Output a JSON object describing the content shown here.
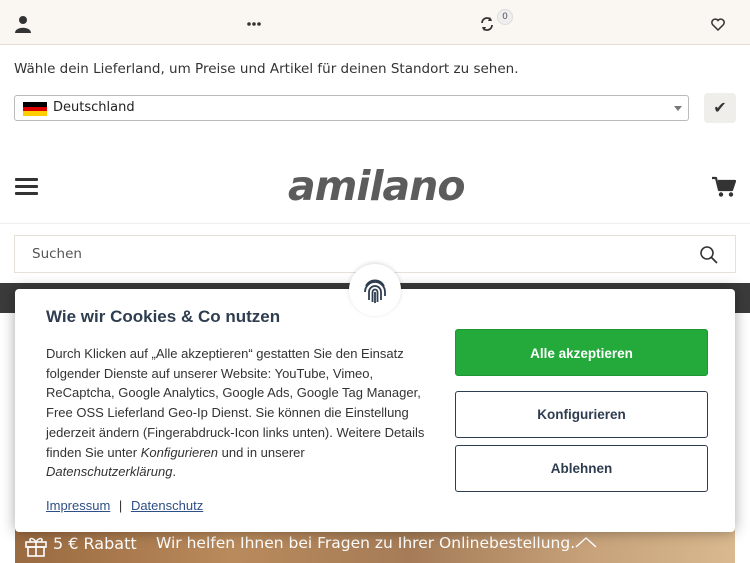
{
  "topbar": {
    "compare_count": "0",
    "icons": [
      "user-icon",
      "more-icon",
      "compare-icon",
      "heart-icon"
    ]
  },
  "country": {
    "prompt": "Wähle dein Lieferland, um Preise und Artikel für deinen Standort zu sehen.",
    "selected": "Deutschland",
    "confirm_label": "✔"
  },
  "header": {
    "logo": "amilano"
  },
  "search": {
    "placeholder": "Suchen"
  },
  "cookie": {
    "title": "Wie wir Cookies & Co nutzen",
    "body_text": "Durch Klicken auf „Alle akzeptieren“ gestatten Sie den Einsatz folgender Dienste auf unserer Website: YouTube, Vimeo, ReCaptcha, Google Analytics, Google Ads, Google Tag Manager, Free OSS Lieferland Geo-Ip Dienst. Sie können die Einstellung jederzeit ändern (Fingerabdruck-Icon links unten). Weitere Details finden Sie unter ",
    "body_em1": "Konfigurieren",
    "body_mid": " und in unserer ",
    "body_em2": "Datenschutzerklärung",
    "body_end": ".",
    "link_impressum": "Impressum",
    "link_sep": "|",
    "link_datenschutz": "Datenschutz",
    "accept_label": "Alle akzeptieren",
    "configure_label": "Konfigurieren",
    "reject_label": "Ablehnen",
    "accent_color": "#23aa3b"
  },
  "banner": {
    "rabatt": "5 € Rabatt",
    "help_text": "Wir helfen Ihnen bei Fragen zu Ihrer Onlinebestellung."
  }
}
